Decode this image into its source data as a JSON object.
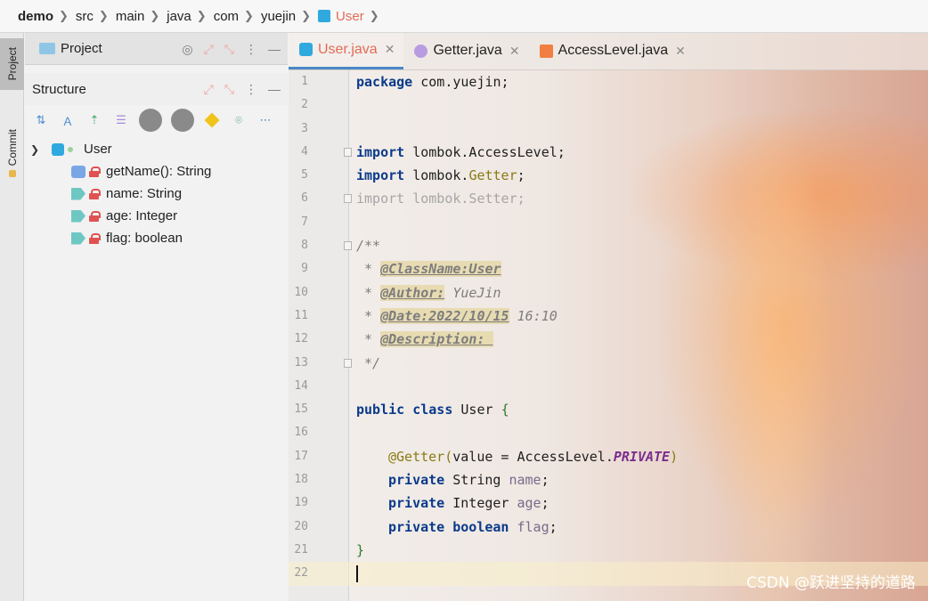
{
  "breadcrumb": [
    "demo",
    "src",
    "main",
    "java",
    "com",
    "yuejin",
    "User"
  ],
  "toolstrip": {
    "project_tab": "Project",
    "commit_tab": "Commit"
  },
  "project_panel": {
    "title": "Project"
  },
  "structure_panel": {
    "title": "Structure",
    "root": "User",
    "members": [
      {
        "label": "getName(): String",
        "kind": "method"
      },
      {
        "label": "name: String",
        "kind": "field"
      },
      {
        "label": "age: Integer",
        "kind": "field"
      },
      {
        "label": "flag: boolean",
        "kind": "field"
      }
    ]
  },
  "editor": {
    "tabs": [
      {
        "label": "User.java",
        "active": true,
        "icon": "class-icon"
      },
      {
        "label": "Getter.java",
        "active": false,
        "icon": "annotation-icon"
      },
      {
        "label": "AccessLevel.java",
        "active": false,
        "icon": "enum-icon"
      }
    ],
    "line_numbers": [
      "1",
      "2",
      "3",
      "4",
      "5",
      "6",
      "7",
      "8",
      "9",
      "10",
      "11",
      "12",
      "13",
      "14",
      "15",
      "16",
      "17",
      "18",
      "19",
      "20",
      "21",
      "22"
    ],
    "code": {
      "l1_kw": "package",
      "l1_rest": " com.yuejin;",
      "l4_kw": "import",
      "l4_rest": " lombok.AccessLevel;",
      "l5_kw": "import",
      "l5_a": " lombok.",
      "l5_anno": "Getter",
      "l5_b": ";",
      "l6": "import lombok.Setter;",
      "l8": "/**",
      "l9_star": " * ",
      "l9_tag": "@ClassName:User",
      "l10_star": " * ",
      "l10_tag": "@Author:",
      "l10_rest": " YueJin",
      "l11_star": " * ",
      "l11_tag": "@Date:2022/10/15",
      "l11_rest": " 16:10",
      "l12_star": " * ",
      "l12_tag": "@Description: ",
      "l13": " */",
      "l15_kw1": "public",
      "l15_kw2": "class",
      "l15_name": " User ",
      "l15_brace": "{",
      "l17_anno": "@Getter",
      "l17_paren": "(",
      "l17_mid": "value = AccessLevel.",
      "l17_const": "PRIVATE",
      "l17_close": ")",
      "l18_kw": "private",
      "l18_type": " String ",
      "l18_fld": "name",
      "l18_end": ";",
      "l19_kw": "private",
      "l19_type": " Integer ",
      "l19_fld": "age",
      "l19_end": ";",
      "l20_kw": "private",
      "l20_kw2": " boolean",
      "l20_sp": " ",
      "l20_fld": "flag",
      "l20_end": ";",
      "l21_brace": "}"
    }
  },
  "watermark": "CSDN @跃进坚持的道路"
}
